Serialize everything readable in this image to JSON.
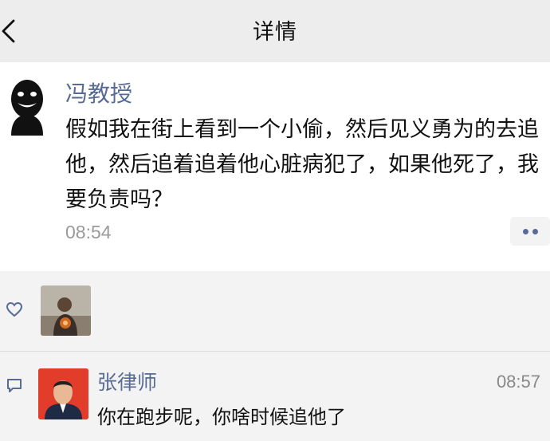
{
  "header": {
    "title": "详情",
    "back_icon": "chevron-left-icon"
  },
  "post": {
    "author": "冯教授",
    "content": "假如我在街上看到一个小偷，然后见义勇为的去追他，然后追着追着他心脏病犯了，如果他死了，我要负责吗？",
    "time": "08:54",
    "more_icon": "two-dots-icon"
  },
  "likes": {
    "icon": "heart-outline-icon"
  },
  "comments": [
    {
      "author": "张律师",
      "time": "08:57",
      "text": "你在跑步呢，你啥时候追他了",
      "icon": "comment-bubble-icon"
    }
  ],
  "colors": {
    "name": "#576b95",
    "header_bg": "#ededed",
    "interaction_bg": "#f3f3f3"
  }
}
